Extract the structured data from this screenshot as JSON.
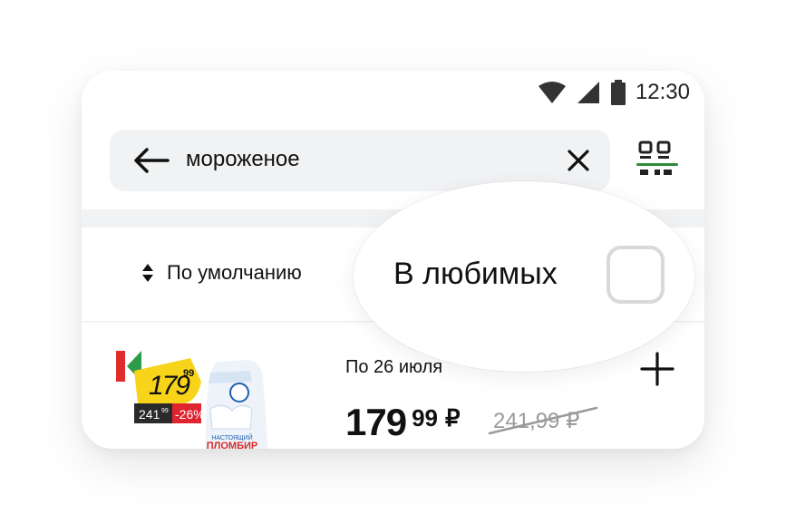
{
  "status_bar": {
    "time": "12:30"
  },
  "search": {
    "query": "мороженое"
  },
  "sort": {
    "label": "По умолчанию"
  },
  "favorites_filter": {
    "label": "В любимых",
    "checked": false
  },
  "product": {
    "date": "По 26 июля",
    "price_main": "179",
    "price_kop": "99",
    "currency": "₽",
    "old_price": "241,99 ₽",
    "badge_price_main": "179",
    "badge_price_kop": "99",
    "badge_old_main": "241",
    "badge_old_kop": "99",
    "badge_discount": "-26%",
    "pack_text": "ПЛОМБИР",
    "pack_subtext": "НАСТОЯЩИЙ"
  },
  "colors": {
    "accent_green": "#2e8b3a",
    "badge_yellow": "#f7d31a",
    "badge_red": "#e0242f",
    "logo_red": "#e02b2b",
    "logo_green": "#2c9b49"
  }
}
